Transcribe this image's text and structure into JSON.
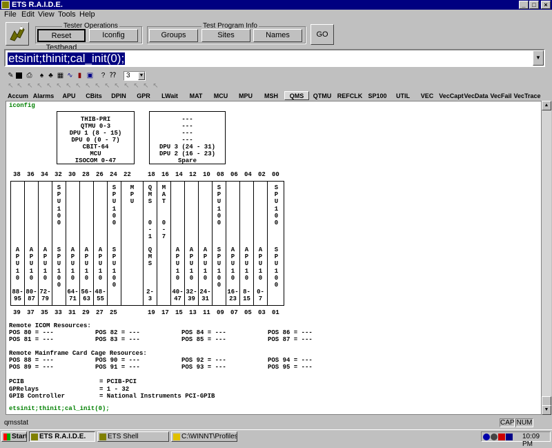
{
  "window": {
    "title": "ETS R.A.I.D.E.",
    "min_glyph": "_",
    "max_glyph": "□",
    "close_glyph": "×"
  },
  "menu": [
    "File",
    "Edit",
    "View",
    "Tools",
    "Help"
  ],
  "toolbar": {
    "tester_ops_label": "Tester Operations",
    "reset_label": "Reset Testhead",
    "iconfig_label": "Iconfig",
    "program_info_label": "Test Program Info",
    "groups_label": "Groups",
    "sites_label": "Sites",
    "names_label": "Names",
    "go_label": "GO"
  },
  "command": {
    "value": "etsinit;thinit;cal_init(0);"
  },
  "icon_toolbar": {
    "icons": [
      "pencil-icon",
      "save-icon",
      "print-icon",
      "spade-icon",
      "club-icon",
      "grid-icon",
      "chart-icon",
      "bar-chart-icon",
      "image-icon",
      "help-icon",
      "whatsthis-icon"
    ],
    "spinner_value": "3"
  },
  "tabs": [
    "Accum",
    "Alarms",
    "APU",
    "CBits",
    "DPIN",
    "GPR",
    "LWait",
    "MAT",
    "MCU",
    "MPU",
    "MSH",
    "QMS",
    "QTMU",
    "REFCLK",
    "SP100",
    "UTIL",
    "VEC",
    "VecCapt",
    "VecData",
    "VecFail",
    "VecTrace"
  ],
  "active_tab": "QMS",
  "content": {
    "header": "iconfig",
    "box1_lines": [
      "THIB-PRI",
      "QTMU 0-3",
      "DPU 1  (8 - 15)",
      "DPU 0  (0 - 7)",
      "CBIT-64",
      "MCU",
      "ISOCOM 0-47"
    ],
    "box2_lines": [
      "---",
      "---",
      "---",
      "---",
      "DPU 3  (24 - 31)",
      "DPU 2  (16 - 23)",
      "Spare"
    ],
    "top_slots": [
      "38",
      "36",
      "34",
      "32",
      "30",
      "28",
      "26",
      "24",
      "22",
      "18",
      "16",
      "14",
      "12",
      "10",
      "08",
      "06",
      "04",
      "02",
      "00"
    ],
    "bottom_slots": [
      "39",
      "37",
      "35",
      "33",
      "31",
      "29",
      "27",
      "25",
      "19",
      "17",
      "15",
      "13",
      "11",
      "09",
      "07",
      "05",
      "03",
      "01"
    ],
    "upper_cards": [
      {
        "text": ""
      },
      {
        "text": ""
      },
      {
        "text": ""
      },
      {
        "text": "S\nP\nU\n1\n0\n0"
      },
      {
        "text": ""
      },
      {
        "text": ""
      },
      {
        "text": ""
      },
      {
        "text": "S\nP\nU\n1\n0\n0"
      },
      {
        "text": "M\nP\nU"
      },
      {
        "text": "Q\nM\nS\n\n\n0\n-\n1"
      },
      {
        "text": "M\nA\nT\n\n\n0\n-\n7"
      },
      {
        "text": ""
      },
      {
        "text": ""
      },
      {
        "text": ""
      },
      {
        "text": "S\nP\nU\n1\n0\n0"
      },
      {
        "text": ""
      },
      {
        "text": ""
      },
      {
        "text": ""
      },
      {
        "text": "S\nP\nU\n1\n0\n0"
      }
    ],
    "lower_cards": [
      {
        "text": "A\nP\nU\n1\n0\n\n88-\n95"
      },
      {
        "text": "A\nP\nU\n1\n0\n\n80-\n87"
      },
      {
        "text": "A\nP\nU\n1\n0\n\n72-\n79"
      },
      {
        "text": "S\nP\nU\n1\n0\n0"
      },
      {
        "text": "A\nP\nU\n1\n0\n\n64-\n71"
      },
      {
        "text": "A\nP\nU\n1\n0\n\n56-\n63"
      },
      {
        "text": "A\nP\nU\n1\n0\n\n48-\n55"
      },
      {
        "text": "S\nP\nU\n1\n0\n0"
      },
      {
        "text": ""
      },
      {
        "text": "Q\nM\nS\n\n\n\n2-\n3"
      },
      {
        "text": ""
      },
      {
        "text": "A\nP\nU\n1\n0\n\n40-\n47"
      },
      {
        "text": "A\nP\nU\n1\n0\n\n32-\n39"
      },
      {
        "text": "A\nP\nU\n1\n0\n\n24-\n31"
      },
      {
        "text": "S\nP\nU\n1\n0\n0"
      },
      {
        "text": "A\nP\nU\n1\n0\n\n16-\n23"
      },
      {
        "text": "A\nP\nU\n1\n0\n\n8-\n15"
      },
      {
        "text": "A\nP\nU\n1\n0\n\n0-\n7"
      },
      {
        "text": "S\nP\nU\n1\n0\n0"
      }
    ],
    "remote_icom_title": "Remote ICOM Resources:",
    "remote_icom": [
      [
        "POS 80 =  ---",
        "POS 82 =  ---",
        "POS 84 =  ---",
        "POS 86 =  ---"
      ],
      [
        "POS 81 =  ---",
        "POS 83 =  ---",
        "POS 85 =  ---",
        "POS 87 =  ---"
      ]
    ],
    "remote_mainframe_title": "Remote Mainframe Card Cage Resources:",
    "remote_mainframe": [
      [
        "POS 88 =  ---",
        "POS 90 =  ---",
        "POS 92 =  ---",
        "POS 94 =  ---"
      ],
      [
        "POS 89 =  ---",
        "POS 91 =  ---",
        "POS 93 =  ---",
        "POS 95 =  ---"
      ]
    ],
    "config": [
      {
        "key": "PCIB",
        "value": "=  PCIB-PCI"
      },
      {
        "key": "GPRelays",
        "value": "=  1 - 32"
      },
      {
        "key": "GPIB Controller",
        "value": "=  National Instruments PCI-GPIB"
      }
    ],
    "last_command": "etsinit;thinit;cal_init(0);"
  },
  "status": {
    "left": "qmsstat",
    "cap": "CAP",
    "num": "NUM"
  },
  "taskbar": {
    "start": "Start",
    "items": [
      "ETS R.A.I.D.E.",
      "ETS Shell",
      "C:\\WINNT\\Profiles\\..."
    ],
    "time": "10:09 PM"
  },
  "colors": {
    "titlebar": "#000080",
    "text_green": "#008000",
    "selection": "#000080"
  }
}
